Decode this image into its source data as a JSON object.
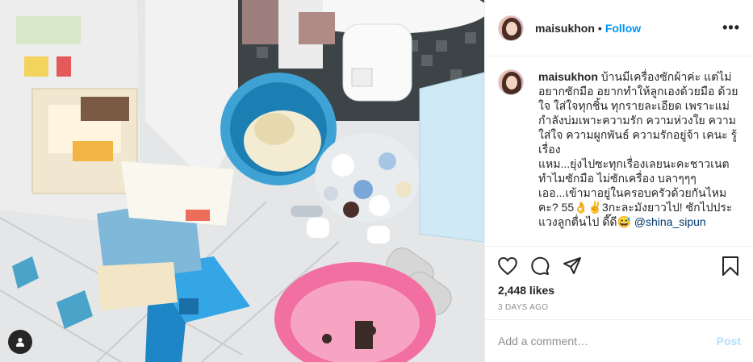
{
  "post": {
    "username": "maisukhon",
    "separator": "•",
    "follow_label": "Follow",
    "more_label": "•••",
    "caption": {
      "username": "maisukhon",
      "line1": "บ้านมีเครื่องซักผ้าค่ะ แต่ไม่อยากซักมือ อยากทำให้ลูกเองด้วยมือ ด้วยใจ ใส่ใจทุกชิ้น ทุกรายละเอียด เพราะแม่กำลังบ่มเพาะความรัก ความห่วงใย ความใส่ใจ ความผูกพันธ์ ความรักอยู่จ้า เคนะ รู้เรื่อง",
      "line2": "แหม...ยุ่งไปซะทุกเรื่องเลยนะคะชาวเนตทำไมซักมือ ไม่ซักเครื่อง บลาๆๆๆ",
      "line3": "เออ...เข้ามาอยู่ในครอบครัวด้วยกันไหมคะ? 55👌✌️3กะละมังยาวไป! ซักไปประแวงลูกตื่นไป ดี๊ดี😅",
      "mention": "@shina_sipun"
    },
    "likes": "2,448 likes",
    "timestamp": "3 DAYS AGO",
    "comment_placeholder": "Add a comment…",
    "post_label": "Post"
  },
  "icons": {
    "like": "heart-icon",
    "comment": "comment-bubble-icon",
    "share": "paper-plane-icon",
    "save": "bookmark-icon",
    "tagged": "user-tag-icon"
  },
  "colors": {
    "follow": "#0095f6",
    "post_disabled": "#b2dffc",
    "text": "#262626",
    "muted": "#8e8e8e"
  }
}
